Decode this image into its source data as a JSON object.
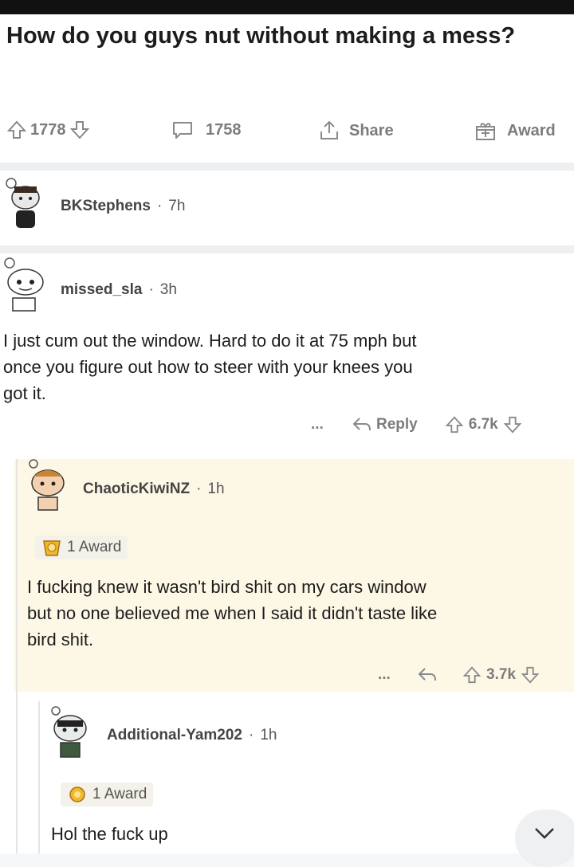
{
  "post": {
    "title": "How do you guys nut without making a mess?",
    "upvotes": "1778",
    "comments": "1758",
    "share_label": "Share",
    "award_label": "Award"
  },
  "comments": [
    {
      "author": "BKStephens",
      "age": "7h"
    },
    {
      "author": "missed_sla",
      "age": "3h",
      "lines": [
        "I just cum out the window. Hard to do it at 75 mph but",
        "once you figure out how to steer with your knees you",
        "got it."
      ],
      "reply_label": "Reply",
      "score": "6.7k"
    },
    {
      "author": "ChaoticKiwiNZ",
      "age": "1h",
      "award": "1 Award",
      "lines": [
        "I fucking knew it wasn't bird shit on my cars window",
        "but no one believed me when I said it didn't taste like",
        "bird shit."
      ],
      "score": "3.7k"
    },
    {
      "author": "Additional-Yam202",
      "age": "1h",
      "award": "1 Award",
      "lines": [
        "Hol the fuck up"
      ]
    }
  ],
  "more_label": "...",
  "dot": "·"
}
